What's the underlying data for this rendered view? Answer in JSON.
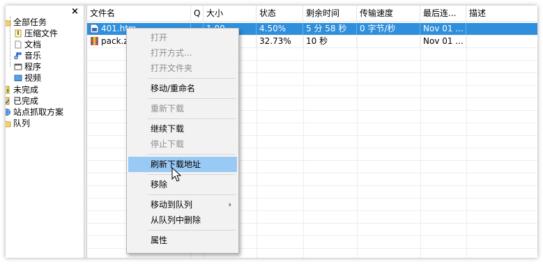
{
  "tree": {
    "close_glyph": "×",
    "items": [
      {
        "label": "全部任务",
        "icon": "folder-open-icon"
      },
      {
        "label": "压缩文件",
        "icon": "archive-icon"
      },
      {
        "label": "文档",
        "icon": "document-icon"
      },
      {
        "label": "音乐",
        "icon": "music-icon"
      },
      {
        "label": "程序",
        "icon": "program-window-icon"
      },
      {
        "label": "视频",
        "icon": "video-icon"
      },
      {
        "label": "未完成",
        "icon": "incomplete-icon"
      },
      {
        "label": "已完成",
        "icon": "completed-icon"
      },
      {
        "label": "站点抓取方案",
        "icon": "site-grab-icon"
      },
      {
        "label": "队列",
        "icon": "queue-folder-icon"
      }
    ]
  },
  "columns": [
    "文件名",
    "Q",
    "大小",
    "状态",
    "剩余时间",
    "传输速度",
    "最后连...",
    "描述"
  ],
  "rows": [
    {
      "name": "401.htm",
      "q": "",
      "size": "1.00 ...",
      "status": "4.50%",
      "remaining": "5 分 58 秒",
      "speed": "0 字节/秒",
      "last": "Nov 01 ...",
      "desc": "",
      "icon": "html-file-icon",
      "selected": true
    },
    {
      "name": "pack.zip",
      "q": "",
      "size": "…8",
      "status": "32.73%",
      "remaining": "10 秒",
      "speed": "",
      "last": "Nov 01 ...",
      "desc": "",
      "icon": "zip-file-icon",
      "selected": false
    }
  ],
  "context_menu": {
    "items": [
      {
        "label": "打开",
        "disabled": true
      },
      {
        "label": "打开方式...",
        "disabled": true
      },
      {
        "label": "打开文件夹",
        "disabled": true
      },
      {
        "label": "移动/重命名",
        "disabled": false
      },
      {
        "label": "重新下载",
        "disabled": true
      },
      {
        "label": "继续下载",
        "disabled": false
      },
      {
        "label": "停止下载",
        "disabled": true
      },
      {
        "label": "刷新下载地址",
        "disabled": false,
        "highlighted": true
      },
      {
        "label": "移除",
        "disabled": false
      },
      {
        "label": "移动到队列",
        "disabled": false,
        "submenu": true
      },
      {
        "label": "从队列中删除",
        "disabled": false
      },
      {
        "label": "属性",
        "disabled": false
      }
    ],
    "submenu_glyph": "›"
  },
  "colors": {
    "selection": "#2f8fdc",
    "menu_highlight": "#99c9f5",
    "menu_background": "#f2f2f2",
    "disabled_text": "#8d8d8d"
  }
}
